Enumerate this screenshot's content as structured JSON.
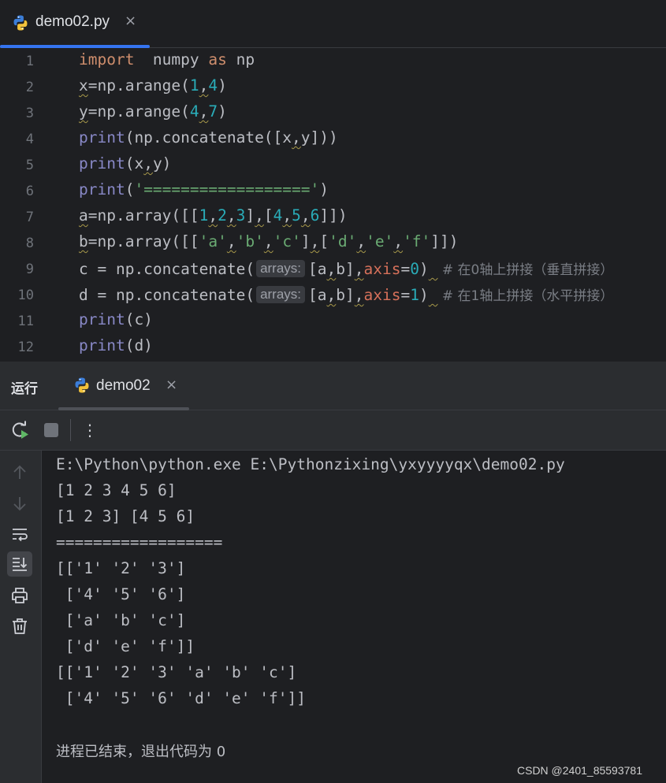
{
  "editor_tab": {
    "title": "demo02.py",
    "close_glyph": "×"
  },
  "code_lines": [
    {
      "num": "1",
      "tokens": [
        [
          "kw",
          "import"
        ],
        [
          "",
          "  numpy "
        ],
        [
          "kw",
          "as"
        ],
        [
          "",
          " np"
        ]
      ]
    },
    {
      "num": "2",
      "tokens": [
        [
          "sq",
          "x"
        ],
        [
          "",
          "=np.arange("
        ],
        [
          "num",
          "1"
        ],
        [
          "sq",
          ","
        ],
        [
          "num",
          "4"
        ],
        [
          "",
          ")"
        ]
      ]
    },
    {
      "num": "3",
      "tokens": [
        [
          "sq",
          "y"
        ],
        [
          "",
          "=np.arange("
        ],
        [
          "num",
          "4"
        ],
        [
          "sq",
          ","
        ],
        [
          "num",
          "7"
        ],
        [
          "",
          ")"
        ]
      ]
    },
    {
      "num": "4",
      "tokens": [
        [
          "fn",
          "print"
        ],
        [
          "",
          "(np.concatenate([x"
        ],
        [
          "sq",
          ","
        ],
        [
          "",
          "y]))"
        ]
      ]
    },
    {
      "num": "5",
      "tokens": [
        [
          "fn",
          "print"
        ],
        [
          "",
          "(x"
        ],
        [
          "sq",
          ","
        ],
        [
          "",
          "y)"
        ]
      ]
    },
    {
      "num": "6",
      "tokens": [
        [
          "fn",
          "print"
        ],
        [
          "",
          "("
        ],
        [
          "str",
          "'=================='"
        ],
        [
          "",
          ")"
        ]
      ]
    },
    {
      "num": "7",
      "tokens": [
        [
          "sq",
          "a"
        ],
        [
          "",
          "=np.array([["
        ],
        [
          "num",
          "1"
        ],
        [
          "sq",
          ","
        ],
        [
          "num",
          "2"
        ],
        [
          "sq",
          ","
        ],
        [
          "num",
          "3"
        ],
        [
          "",
          "]"
        ],
        [
          "sq",
          ","
        ],
        [
          "",
          "["
        ],
        [
          "num",
          "4"
        ],
        [
          "sq",
          ","
        ],
        [
          "num",
          "5"
        ],
        [
          "sq",
          ","
        ],
        [
          "num",
          "6"
        ],
        [
          "",
          "]])"
        ]
      ]
    },
    {
      "num": "8",
      "tokens": [
        [
          "sq",
          "b"
        ],
        [
          "",
          "=np.array([["
        ],
        [
          "str",
          "'a'"
        ],
        [
          "sq",
          ","
        ],
        [
          "str",
          "'b'"
        ],
        [
          "sq",
          ","
        ],
        [
          "str",
          "'c'"
        ],
        [
          "",
          "]"
        ],
        [
          "sq",
          ","
        ],
        [
          "",
          "["
        ],
        [
          "str",
          "'d'"
        ],
        [
          "sq",
          ","
        ],
        [
          "str",
          "'e'"
        ],
        [
          "sq",
          ","
        ],
        [
          "str",
          "'f'"
        ],
        [
          "",
          "]])"
        ]
      ]
    },
    {
      "num": "9",
      "tokens": [
        [
          "",
          "c = np.concatenate("
        ],
        [
          "hint",
          "arrays:"
        ],
        [
          "",
          "[a"
        ],
        [
          "sq",
          ","
        ],
        [
          "",
          "b]"
        ],
        [
          "sq",
          ","
        ],
        [
          "param",
          "axis"
        ],
        [
          "",
          "="
        ],
        [
          "num",
          "0"
        ],
        [
          "",
          ")"
        ],
        [
          "sq",
          " "
        ],
        [
          "cm",
          " # 在0轴上拼接（垂直拼接）"
        ]
      ]
    },
    {
      "num": "10",
      "tokens": [
        [
          "",
          "d = np.concatenate("
        ],
        [
          "hint",
          "arrays:"
        ],
        [
          "",
          "[a"
        ],
        [
          "sq",
          ","
        ],
        [
          "",
          "b]"
        ],
        [
          "sq",
          ","
        ],
        [
          "param",
          "axis"
        ],
        [
          "",
          "="
        ],
        [
          "num",
          "1"
        ],
        [
          "",
          ")"
        ],
        [
          "sq",
          " "
        ],
        [
          "cm",
          " # 在1轴上拼接（水平拼接）"
        ]
      ]
    },
    {
      "num": "11",
      "tokens": [
        [
          "fn",
          "print"
        ],
        [
          "",
          "(c)"
        ]
      ]
    },
    {
      "num": "12",
      "tokens": [
        [
          "fn",
          "print"
        ],
        [
          "",
          "(d)"
        ]
      ]
    }
  ],
  "run_panel": {
    "label": "运行",
    "tab_title": "demo02",
    "close_glyph": "×",
    "more_glyph": "⋮"
  },
  "toolbar_icons": [
    "rerun-icon",
    "stop-icon",
    "more-options-icon"
  ],
  "side_icons": [
    "arrow-up-icon",
    "arrow-down-icon",
    "soft-wrap-icon",
    "scroll-to-end-icon",
    "print-icon",
    "trash-icon"
  ],
  "console": {
    "lines": [
      "E:\\Python\\python.exe E:\\Pythonzixing\\yxyyyyqx\\demo02.py",
      "[1 2 3 4 5 6]",
      "[1 2 3] [4 5 6]",
      "==================",
      "[['1' '2' '3']",
      " ['4' '5' '6']",
      " ['a' 'b' 'c']",
      " ['d' 'e' 'f']]",
      "[['1' '2' '3' 'a' 'b' 'c']",
      " ['4' '5' '6' 'd' 'e' 'f']]"
    ],
    "exit_message": "进程已结束，退出代码为 0"
  },
  "watermark": "CSDN @2401_85593781",
  "colors": {
    "background": "#1e1f22",
    "panel": "#2b2d30",
    "accent": "#3574f0",
    "keyword": "#cf8e6d",
    "number": "#2aacb8",
    "string": "#6aab73",
    "builtin": "#8888c6"
  }
}
